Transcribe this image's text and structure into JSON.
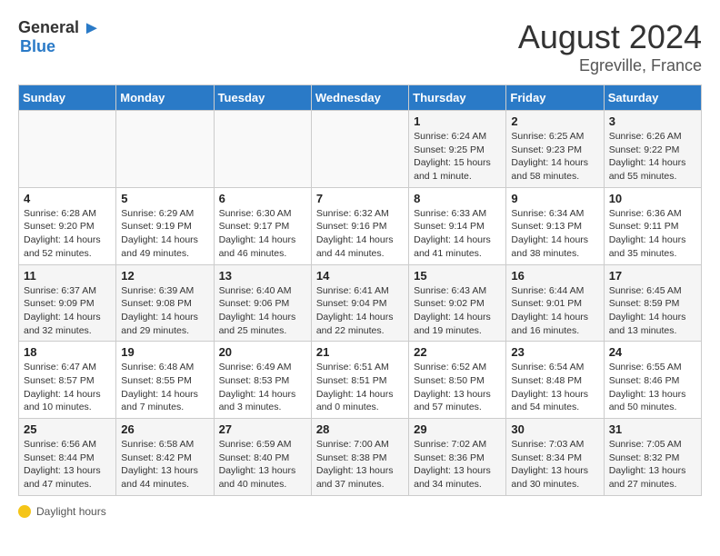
{
  "header": {
    "logo_general": "General",
    "logo_blue": "Blue",
    "month": "August 2024",
    "location": "Egreville, France"
  },
  "days_of_week": [
    "Sunday",
    "Monday",
    "Tuesday",
    "Wednesday",
    "Thursday",
    "Friday",
    "Saturday"
  ],
  "footer_label": "Daylight hours",
  "weeks": [
    [
      {
        "day": "",
        "info": ""
      },
      {
        "day": "",
        "info": ""
      },
      {
        "day": "",
        "info": ""
      },
      {
        "day": "",
        "info": ""
      },
      {
        "day": "1",
        "info": "Sunrise: 6:24 AM\nSunset: 9:25 PM\nDaylight: 15 hours\nand 1 minute."
      },
      {
        "day": "2",
        "info": "Sunrise: 6:25 AM\nSunset: 9:23 PM\nDaylight: 14 hours\nand 58 minutes."
      },
      {
        "day": "3",
        "info": "Sunrise: 6:26 AM\nSunset: 9:22 PM\nDaylight: 14 hours\nand 55 minutes."
      }
    ],
    [
      {
        "day": "4",
        "info": "Sunrise: 6:28 AM\nSunset: 9:20 PM\nDaylight: 14 hours\nand 52 minutes."
      },
      {
        "day": "5",
        "info": "Sunrise: 6:29 AM\nSunset: 9:19 PM\nDaylight: 14 hours\nand 49 minutes."
      },
      {
        "day": "6",
        "info": "Sunrise: 6:30 AM\nSunset: 9:17 PM\nDaylight: 14 hours\nand 46 minutes."
      },
      {
        "day": "7",
        "info": "Sunrise: 6:32 AM\nSunset: 9:16 PM\nDaylight: 14 hours\nand 44 minutes."
      },
      {
        "day": "8",
        "info": "Sunrise: 6:33 AM\nSunset: 9:14 PM\nDaylight: 14 hours\nand 41 minutes."
      },
      {
        "day": "9",
        "info": "Sunrise: 6:34 AM\nSunset: 9:13 PM\nDaylight: 14 hours\nand 38 minutes."
      },
      {
        "day": "10",
        "info": "Sunrise: 6:36 AM\nSunset: 9:11 PM\nDaylight: 14 hours\nand 35 minutes."
      }
    ],
    [
      {
        "day": "11",
        "info": "Sunrise: 6:37 AM\nSunset: 9:09 PM\nDaylight: 14 hours\nand 32 minutes."
      },
      {
        "day": "12",
        "info": "Sunrise: 6:39 AM\nSunset: 9:08 PM\nDaylight: 14 hours\nand 29 minutes."
      },
      {
        "day": "13",
        "info": "Sunrise: 6:40 AM\nSunset: 9:06 PM\nDaylight: 14 hours\nand 25 minutes."
      },
      {
        "day": "14",
        "info": "Sunrise: 6:41 AM\nSunset: 9:04 PM\nDaylight: 14 hours\nand 22 minutes."
      },
      {
        "day": "15",
        "info": "Sunrise: 6:43 AM\nSunset: 9:02 PM\nDaylight: 14 hours\nand 19 minutes."
      },
      {
        "day": "16",
        "info": "Sunrise: 6:44 AM\nSunset: 9:01 PM\nDaylight: 14 hours\nand 16 minutes."
      },
      {
        "day": "17",
        "info": "Sunrise: 6:45 AM\nSunset: 8:59 PM\nDaylight: 14 hours\nand 13 minutes."
      }
    ],
    [
      {
        "day": "18",
        "info": "Sunrise: 6:47 AM\nSunset: 8:57 PM\nDaylight: 14 hours\nand 10 minutes."
      },
      {
        "day": "19",
        "info": "Sunrise: 6:48 AM\nSunset: 8:55 PM\nDaylight: 14 hours\nand 7 minutes."
      },
      {
        "day": "20",
        "info": "Sunrise: 6:49 AM\nSunset: 8:53 PM\nDaylight: 14 hours\nand 3 minutes."
      },
      {
        "day": "21",
        "info": "Sunrise: 6:51 AM\nSunset: 8:51 PM\nDaylight: 14 hours\nand 0 minutes."
      },
      {
        "day": "22",
        "info": "Sunrise: 6:52 AM\nSunset: 8:50 PM\nDaylight: 13 hours\nand 57 minutes."
      },
      {
        "day": "23",
        "info": "Sunrise: 6:54 AM\nSunset: 8:48 PM\nDaylight: 13 hours\nand 54 minutes."
      },
      {
        "day": "24",
        "info": "Sunrise: 6:55 AM\nSunset: 8:46 PM\nDaylight: 13 hours\nand 50 minutes."
      }
    ],
    [
      {
        "day": "25",
        "info": "Sunrise: 6:56 AM\nSunset: 8:44 PM\nDaylight: 13 hours\nand 47 minutes."
      },
      {
        "day": "26",
        "info": "Sunrise: 6:58 AM\nSunset: 8:42 PM\nDaylight: 13 hours\nand 44 minutes."
      },
      {
        "day": "27",
        "info": "Sunrise: 6:59 AM\nSunset: 8:40 PM\nDaylight: 13 hours\nand 40 minutes."
      },
      {
        "day": "28",
        "info": "Sunrise: 7:00 AM\nSunset: 8:38 PM\nDaylight: 13 hours\nand 37 minutes."
      },
      {
        "day": "29",
        "info": "Sunrise: 7:02 AM\nSunset: 8:36 PM\nDaylight: 13 hours\nand 34 minutes."
      },
      {
        "day": "30",
        "info": "Sunrise: 7:03 AM\nSunset: 8:34 PM\nDaylight: 13 hours\nand 30 minutes."
      },
      {
        "day": "31",
        "info": "Sunrise: 7:05 AM\nSunset: 8:32 PM\nDaylight: 13 hours\nand 27 minutes."
      }
    ]
  ]
}
